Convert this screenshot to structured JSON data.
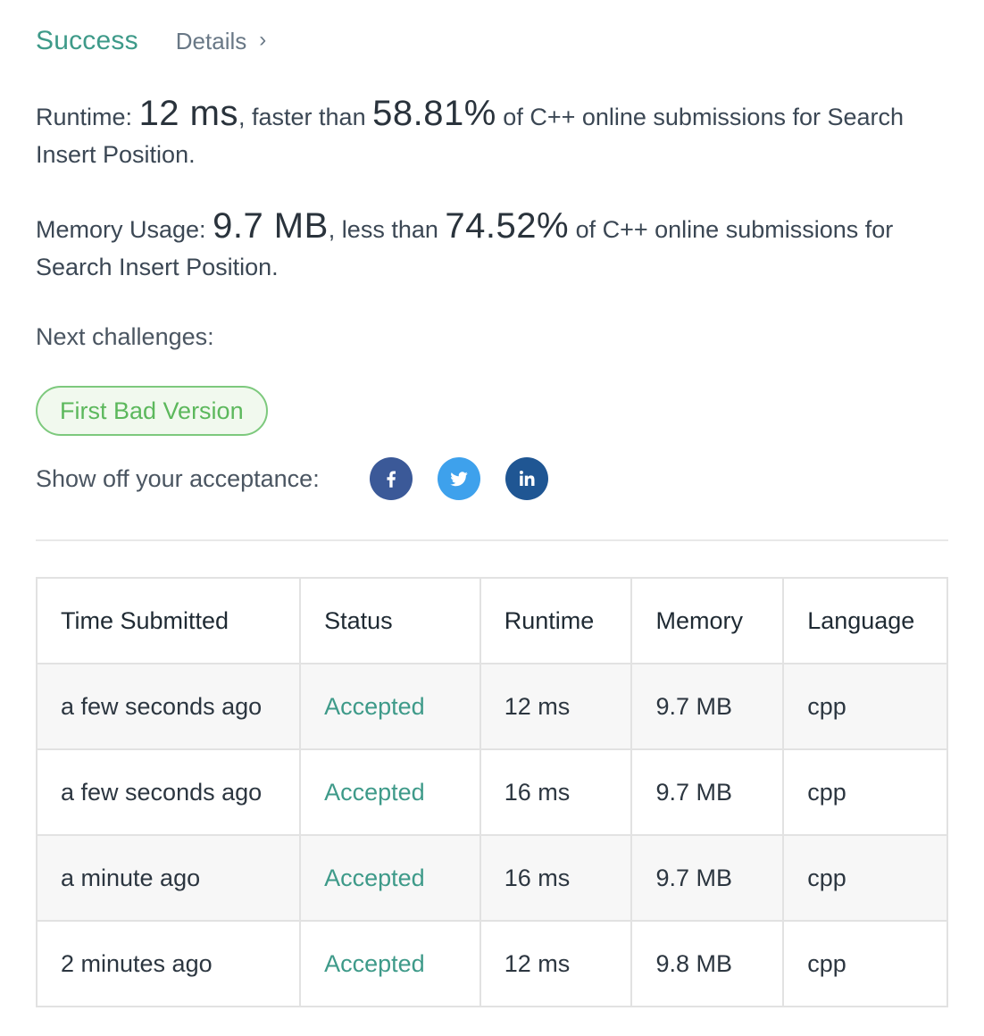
{
  "header": {
    "status": "Success",
    "details_link": "Details",
    "chevron": "›"
  },
  "runtime_stat": {
    "label": "Runtime:",
    "value": "12 ms",
    "mid": ", faster than",
    "percent": "58.81%",
    "suffix": "of C++ online submissions for Search Insert Position."
  },
  "memory_stat": {
    "label": "Memory Usage:",
    "value": "9.7 MB",
    "mid": ", less than",
    "percent": "74.52%",
    "suffix": "of C++ online submissions for Search Insert Position."
  },
  "next": {
    "label": "Next challenges:",
    "challenges": [
      "First Bad Version"
    ]
  },
  "share": {
    "label": "Show off your acceptance:",
    "icons": [
      "facebook-icon",
      "twitter-icon",
      "linkedin-icon"
    ],
    "colors": {
      "facebook": "#3b5998",
      "twitter": "#3ea1ec",
      "linkedin": "#1f5693"
    }
  },
  "submissions": {
    "columns": [
      "Time Submitted",
      "Status",
      "Runtime",
      "Memory",
      "Language"
    ],
    "rows": [
      [
        "a few seconds ago",
        "Accepted",
        "12 ms",
        "9.7 MB",
        "cpp"
      ],
      [
        "a few seconds ago",
        "Accepted",
        "16 ms",
        "9.7 MB",
        "cpp"
      ],
      [
        "a minute ago",
        "Accepted",
        "16 ms",
        "9.7 MB",
        "cpp"
      ],
      [
        "2 minutes ago",
        "Accepted",
        "12 ms",
        "9.8 MB",
        "cpp"
      ]
    ]
  },
  "colors": {
    "success": "#3e9a89",
    "challenge_green": "#5cb85c"
  }
}
